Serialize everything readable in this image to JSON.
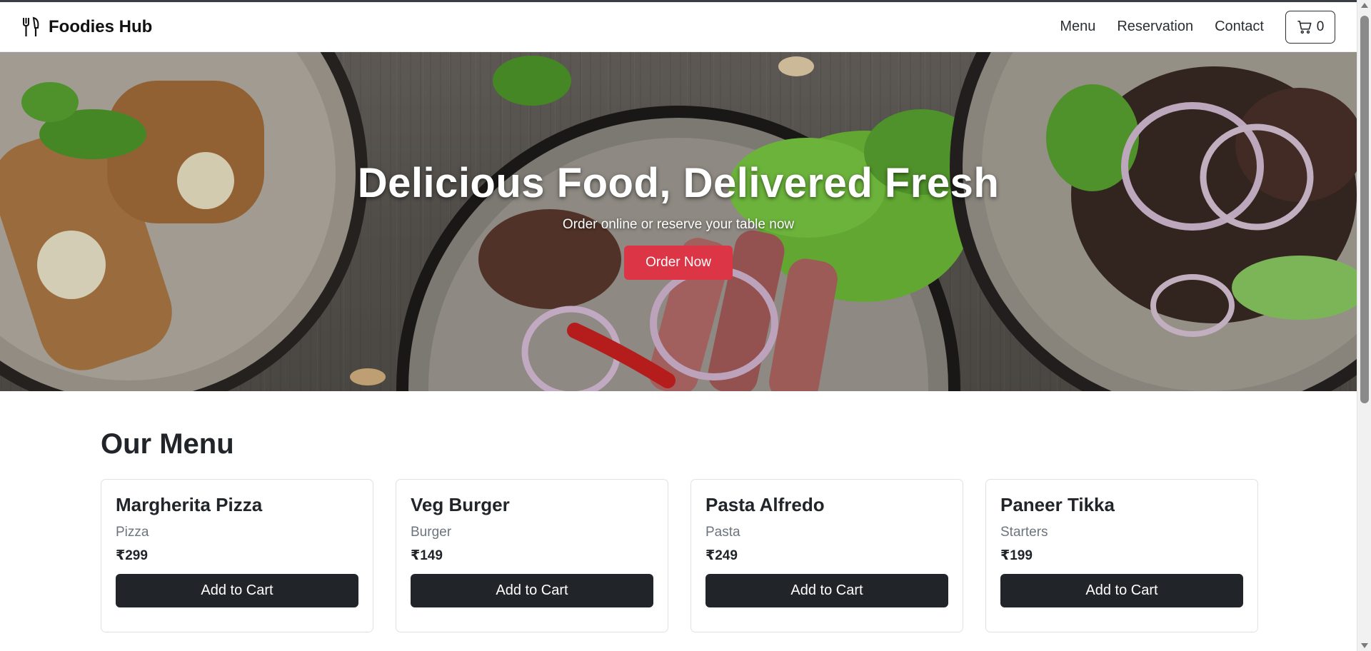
{
  "brand": {
    "name": "Foodies Hub",
    "icon": "fork-knife-icon"
  },
  "nav": {
    "links": [
      "Menu",
      "Reservation",
      "Contact"
    ],
    "cart_icon": "cart-icon",
    "cart_count": "0"
  },
  "hero": {
    "title": "Delicious Food, Delivered Fresh",
    "subtitle": "Order online or reserve your table now",
    "cta_label": "Order Now"
  },
  "menu": {
    "title": "Our Menu",
    "items": [
      {
        "name": "Margherita Pizza",
        "category": "Pizza",
        "price": "₹299",
        "button": "Add to Cart"
      },
      {
        "name": "Veg Burger",
        "category": "Burger",
        "price": "₹149",
        "button": "Add to Cart"
      },
      {
        "name": "Pasta Alfredo",
        "category": "Pasta",
        "price": "₹249",
        "button": "Add to Cart"
      },
      {
        "name": "Paneer Tikka",
        "category": "Starters",
        "price": "₹199",
        "button": "Add to Cart"
      }
    ]
  },
  "colors": {
    "accent_red": "#dc3545",
    "dark": "#212529",
    "muted": "#6c757d"
  }
}
